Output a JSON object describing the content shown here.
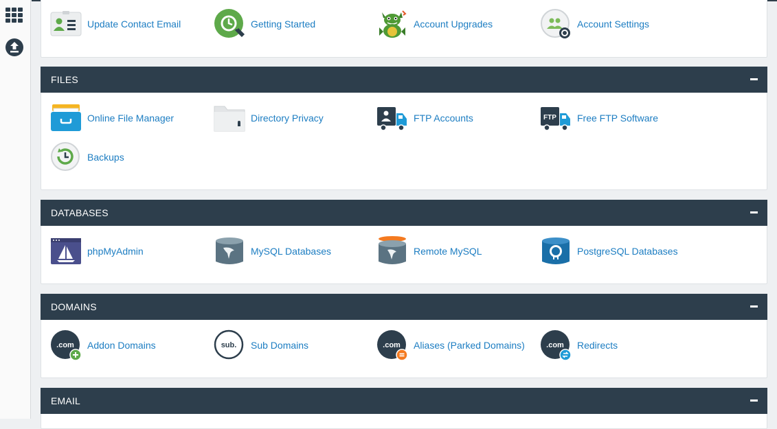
{
  "sidebar": {
    "icons": [
      {
        "name": "apps-grid-icon"
      },
      {
        "name": "upload-icon"
      }
    ]
  },
  "general": {
    "items": [
      {
        "label": "Update Contact Email",
        "icon": "contact-card-icon"
      },
      {
        "label": "Getting Started",
        "icon": "getting-started-icon"
      },
      {
        "label": "Account Upgrades",
        "icon": "dragon-mascot-icon"
      },
      {
        "label": "Account Settings",
        "icon": "account-settings-icon"
      }
    ]
  },
  "files": {
    "title": "FILES",
    "items": [
      {
        "label": "Online File Manager",
        "icon": "file-box-icon"
      },
      {
        "label": "Directory Privacy",
        "icon": "locked-folder-icon"
      },
      {
        "label": "FTP Accounts",
        "icon": "ftp-truck-user-icon"
      },
      {
        "label": "Free FTP Software",
        "icon": "ftp-truck-icon"
      },
      {
        "label": "Backups",
        "icon": "backup-clock-icon"
      }
    ]
  },
  "databases": {
    "title": "DATABASES",
    "items": [
      {
        "label": "phpMyAdmin",
        "icon": "phpmyadmin-icon"
      },
      {
        "label": "MySQL Databases",
        "icon": "mysql-database-icon"
      },
      {
        "label": "Remote MySQL",
        "icon": "remote-mysql-icon"
      },
      {
        "label": "PostgreSQL Databases",
        "icon": "postgresql-icon"
      }
    ]
  },
  "domains": {
    "title": "DOMAINS",
    "items": [
      {
        "label": "Addon Domains",
        "icon": "dotcom-add-icon",
        "badge_text": ".com"
      },
      {
        "label": "Sub Domains",
        "icon": "subdomain-icon",
        "badge_text": "sub."
      },
      {
        "label": "Aliases (Parked Domains)",
        "icon": "dotcom-alias-icon",
        "badge_text": ".com"
      },
      {
        "label": "Redirects",
        "icon": "dotcom-redirect-icon",
        "badge_text": ".com"
      }
    ]
  },
  "email": {
    "title": "EMAIL"
  },
  "colors": {
    "header_bg": "#2d3e4c",
    "link": "#1c7dc2",
    "page_bg": "#eef0f2"
  }
}
